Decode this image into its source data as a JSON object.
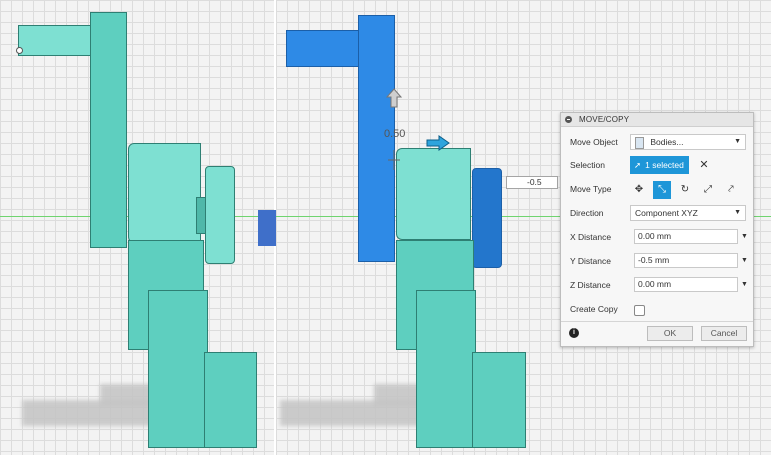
{
  "left_view": {},
  "right_view": {
    "manipulator_value": "0.50",
    "floating_value": "-0.5"
  },
  "panel": {
    "title": "MOVE/COPY",
    "move_object": {
      "label": "Move Object",
      "value": "Bodies...",
      "icon": "body-icon"
    },
    "selection": {
      "label": "Selection",
      "value": "1 selected"
    },
    "move_type": {
      "label": "Move Type",
      "icons": [
        "free-move-icon",
        "translate-icon",
        "rotate-icon",
        "point-to-point-icon",
        "point-to-position-icon"
      ],
      "active_index": 1
    },
    "direction": {
      "label": "Direction",
      "value": "Component XYZ"
    },
    "x_distance": {
      "label": "X Distance",
      "value": "0.00 mm"
    },
    "y_distance": {
      "label": "Y Distance",
      "value": "-0.5 mm"
    },
    "z_distance": {
      "label": "Z Distance",
      "value": "0.00 mm"
    },
    "create_copy": {
      "label": "Create Copy",
      "checked": false
    },
    "ok_label": "OK",
    "cancel_label": "Cancel"
  },
  "colors": {
    "model": "#5ecfbf",
    "selected": "#2e8ae6",
    "accent": "#1e96d8",
    "arrow": "#3f6fc9"
  }
}
